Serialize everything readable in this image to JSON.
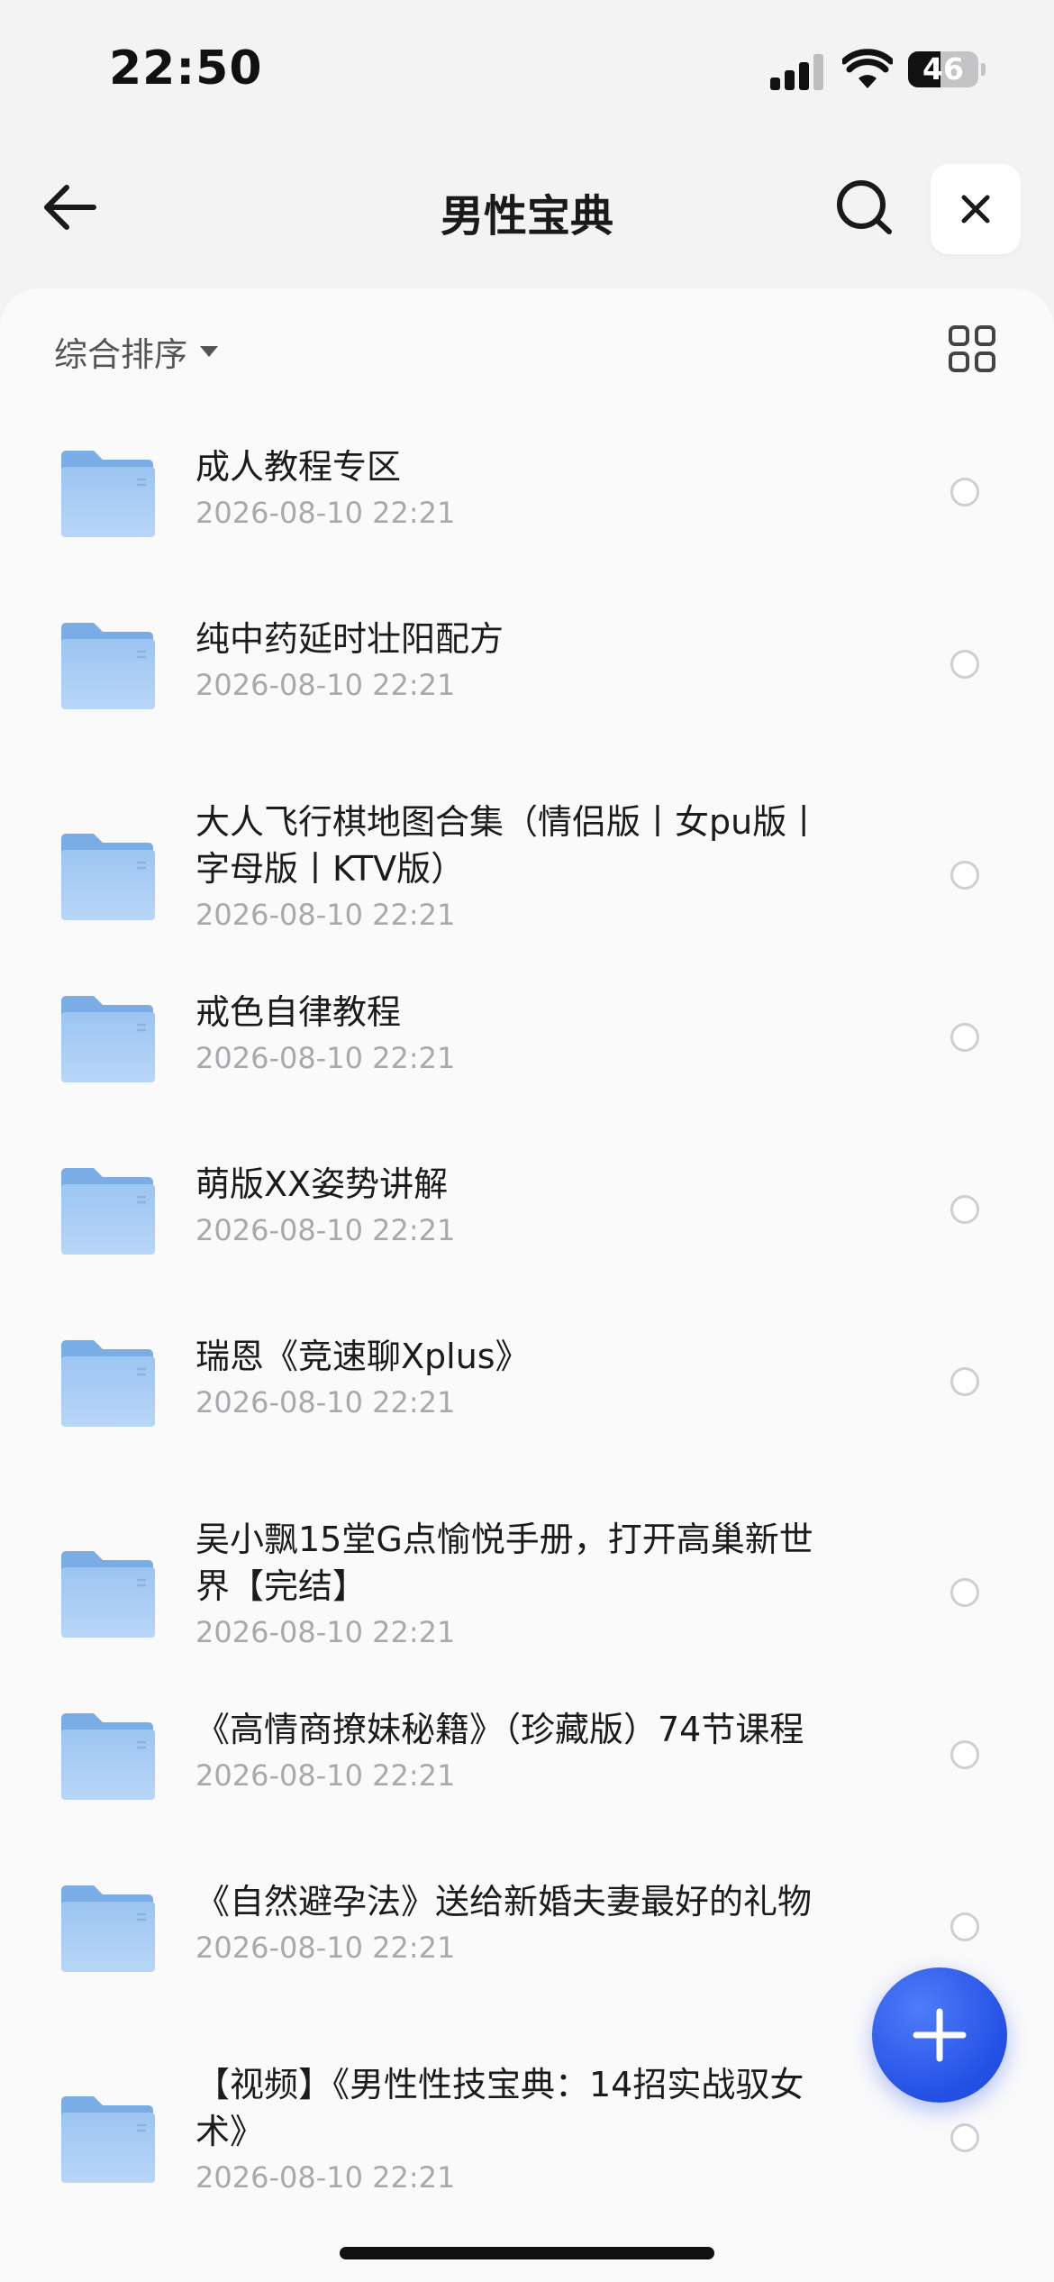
{
  "status_bar": {
    "time": "22:50",
    "battery": "46",
    "battery_level": 0.46
  },
  "header": {
    "title": "男性宝典"
  },
  "toolbar": {
    "sort_label": "综合排序"
  },
  "colors": {
    "accent": "#2f5cf0",
    "folder": "#8fbcef",
    "date_text": "#a9a9ad"
  },
  "icons": {
    "back": "arrow-left-icon",
    "search": "search-icon",
    "close": "close-icon",
    "sort": "caret-down-icon",
    "grid": "grid-view-icon",
    "folder": "folder-icon",
    "fab": "plus-icon"
  },
  "files": [
    {
      "name": "成人教程专区",
      "date": "2026-08-10 22:21"
    },
    {
      "name": "纯中药延时壮阳配方",
      "date": "2026-08-10 22:21"
    },
    {
      "name": "大人飞行棋地图合集（情侣版丨女pu版丨字母版丨KTV版）",
      "date": "2026-08-10 22:21"
    },
    {
      "name": "戒色自律教程",
      "date": "2026-08-10 22:21"
    },
    {
      "name": "萌版XX姿势讲解",
      "date": "2026-08-10 22:21"
    },
    {
      "name": "瑞恩《竞速聊Xplus》",
      "date": "2026-08-10 22:21"
    },
    {
      "name": "吴小飘15堂G点愉悦手册，打开高巢新世界【完结】",
      "date": "2026-08-10 22:21"
    },
    {
      "name": "《高情商撩妹秘籍》（珍藏版）74节课程",
      "date": "2026-08-10 22:21"
    },
    {
      "name": "《自然避孕法》送给新婚夫妻最好的礼物",
      "date": "2026-08-10 22:21"
    },
    {
      "name": "【视频】《男性性技宝典：14招实战驭女术》",
      "date": "2026-08-10 22:21"
    }
  ]
}
